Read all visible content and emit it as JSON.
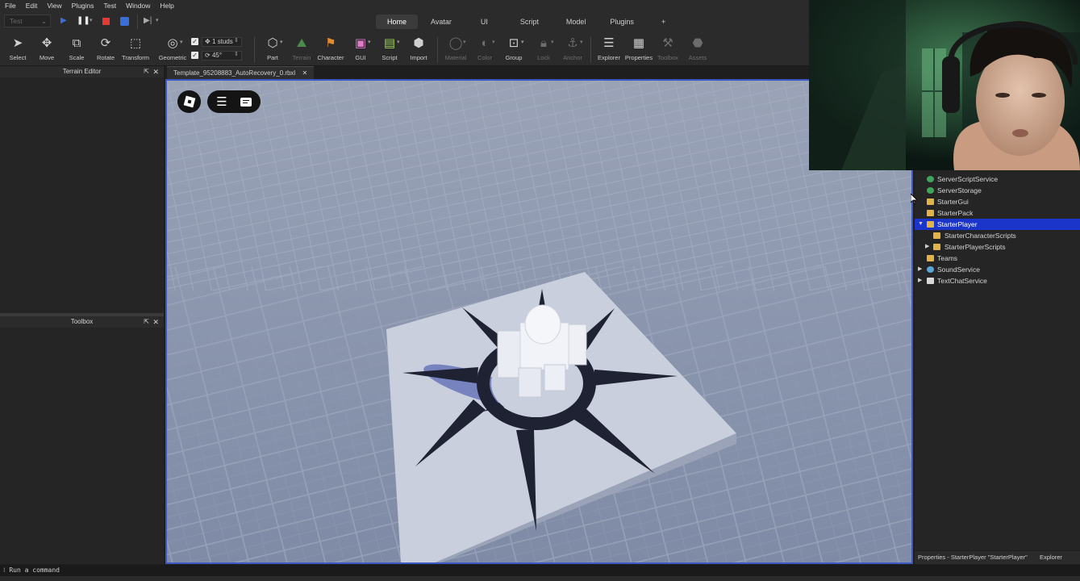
{
  "menu": [
    "File",
    "Edit",
    "View",
    "Plugins",
    "Test",
    "Window",
    "Help"
  ],
  "play_mode": {
    "selected": "Test"
  },
  "ribbon_tabs": [
    {
      "label": "Home",
      "active": true
    },
    {
      "label": "Avatar",
      "active": false
    },
    {
      "label": "UI",
      "active": false
    },
    {
      "label": "Script",
      "active": false
    },
    {
      "label": "Model",
      "active": false
    },
    {
      "label": "Plugins",
      "active": false
    },
    {
      "label": "+",
      "active": false
    }
  ],
  "toolbar": {
    "select": "Select",
    "move": "Move",
    "scale": "Scale",
    "rotate": "Rotate",
    "transform": "Transform",
    "geometric": "Geometric",
    "move_snap": "1 studs",
    "rotate_snap": "45°",
    "part": "Part",
    "terrain": "Terrain",
    "character": "Character",
    "gui": "GUI",
    "script": "Script",
    "import": "Import",
    "material": "Material",
    "color": "Color",
    "group": "Group",
    "lock": "Lock",
    "anchor": "Anchor",
    "explorer": "Explorer",
    "properties": "Properties",
    "toolbox": "Toolbox",
    "assets": "Assets"
  },
  "panels": {
    "terrain_editor": "Terrain Editor",
    "toolbox": "Toolbox"
  },
  "doc_tab": {
    "label": "Template_95208883_AutoRecovery_0.rbxl"
  },
  "explorer": {
    "items": [
      {
        "label": "ServerScriptService",
        "icon": "service-green-icon",
        "expanded": null,
        "selected": false
      },
      {
        "label": "ServerStorage",
        "icon": "service-green-icon",
        "expanded": null,
        "selected": false
      },
      {
        "label": "StarterGui",
        "icon": "folder-icon",
        "expanded": null,
        "selected": false
      },
      {
        "label": "StarterPack",
        "icon": "folder-icon",
        "expanded": null,
        "selected": false
      },
      {
        "label": "StarterPlayer",
        "icon": "folder-icon",
        "expanded": true,
        "selected": true
      },
      {
        "label": "StarterCharacterScripts",
        "icon": "folder-icon",
        "expanded": null,
        "selected": false
      },
      {
        "label": "StarterPlayerScripts",
        "icon": "folder-icon",
        "expanded": false,
        "selected": false
      },
      {
        "label": "Teams",
        "icon": "folder-icon",
        "expanded": null,
        "selected": false
      },
      {
        "label": "SoundService",
        "icon": "sound-icon",
        "expanded": false,
        "selected": false
      },
      {
        "label": "TextChatService",
        "icon": "chat-icon",
        "expanded": false,
        "selected": false
      }
    ],
    "footer_properties": "Properties - StarterPlayer \"StarterPlayer\"",
    "footer_explorer": "Explorer"
  },
  "command_bar": {
    "placeholder": "Run a command"
  },
  "colors": {
    "selection": "#1b34c9",
    "viewport_border": "#3b59c4",
    "stop_red": "#e53935",
    "play_blue": "#3b6fd8"
  }
}
